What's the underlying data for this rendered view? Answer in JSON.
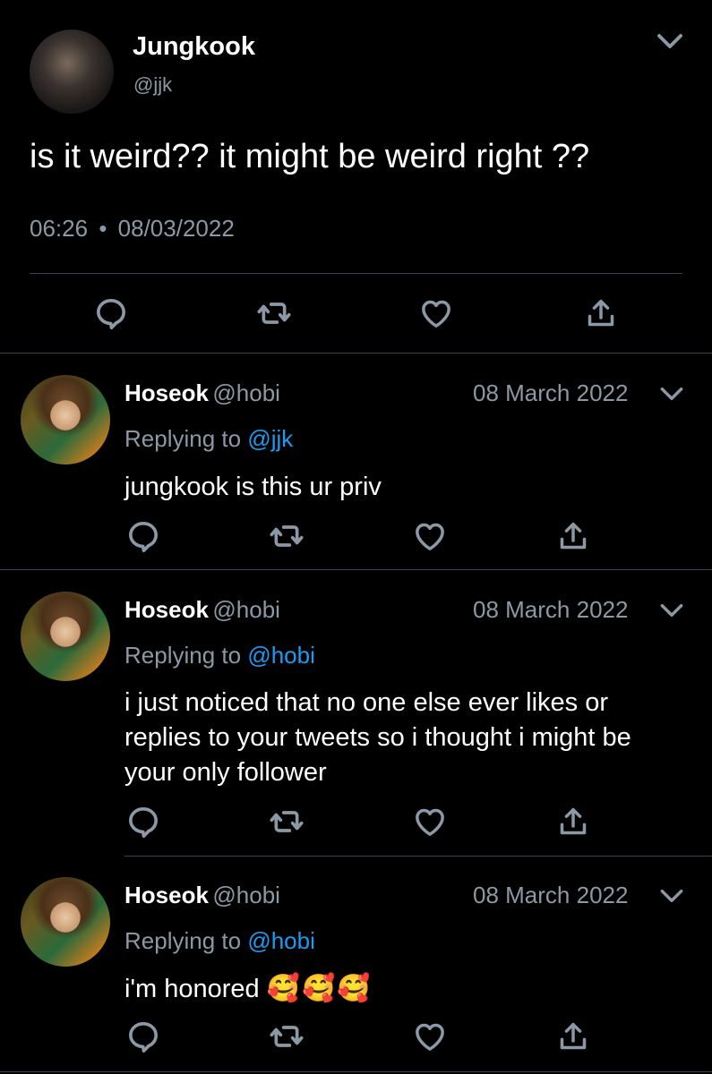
{
  "main_tweet": {
    "name": "Jungkook",
    "handle": "@jjk",
    "text": "is it weird?? it might be weird right ??",
    "time": "06:26",
    "separator": "•",
    "date": "08/03/2022"
  },
  "replies": [
    {
      "name": "Hoseok",
      "handle": "@hobi",
      "date": "08 March 2022",
      "replying_prefix": "Replying to ",
      "replying_to": "@jjk",
      "text": "jungkook is this ur priv"
    },
    {
      "name": "Hoseok",
      "handle": "@hobi",
      "date": "08 March 2022",
      "replying_prefix": "Replying to ",
      "replying_to": "@hobi",
      "text": "i just noticed that no one else ever likes or replies to your tweets so i thought i might be your only follower"
    },
    {
      "name": "Hoseok",
      "handle": "@hobi",
      "date": "08 March 2022",
      "replying_prefix": "Replying to ",
      "replying_to": "@hobi",
      "text": "i'm honored",
      "emojis": "🥰🥰🥰"
    }
  ],
  "colors": {
    "background": "#000000",
    "secondary_text": "#8b98a5",
    "mention": "#1d9bf0",
    "divider": "#38444d",
    "icon": "#8b98a5"
  },
  "icons": [
    "reply-icon",
    "retweet-icon",
    "like-icon",
    "share-icon",
    "chevron-down-icon"
  ]
}
